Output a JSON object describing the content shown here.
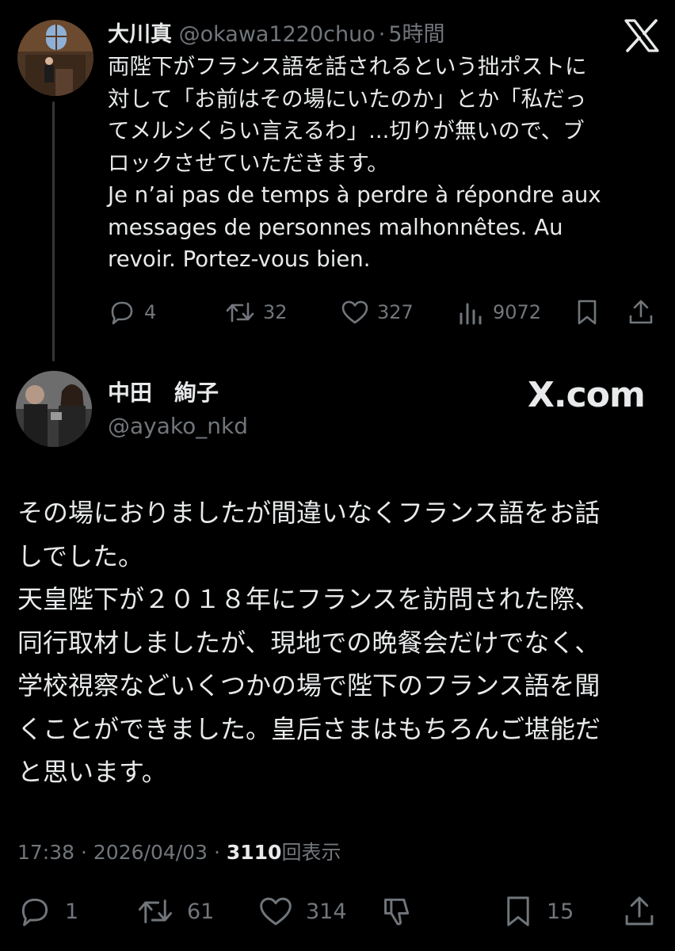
{
  "parent_tweet": {
    "display_name": "大川真",
    "handle": "@okawa1220chuo",
    "separator": "·",
    "time": "5時間",
    "text": "両陛下がフランス語を話されるという拙ポストに\n対して「お前はその場にいたのか」とか「私だっ\nてメルシくらい言えるわ」...切りが無いので、ブ\nロックさせていただきます。\nJe n’ai pas de temps à perdre à répondre aux\nmessages de personnes malhonnêtes. Au\nrevoir. Portez-vous bien.",
    "stats": {
      "replies": "4",
      "reposts": "32",
      "likes": "327",
      "views": "9072"
    }
  },
  "main_tweet": {
    "display_name": "中田　絢子",
    "handle": "@ayako_nkd",
    "brand": "X.com",
    "text": "その場におりましたが間違いなくフランス語をお話\nしでした。\n天皇陛下が２０１８年にフランスを訪問された際、\n同行取材しましたが、現地での晩餐会だけでなく、\n学校視察などいくつかの場で陛下のフランス語を聞\nくことができました。皇后さまはもちろんご堪能だ\nと思います。",
    "time": "17:38",
    "separator": "·",
    "date": "2026/04/03",
    "views_count": "3110",
    "views_label": "回表示",
    "stats": {
      "replies": "1",
      "reposts": "61",
      "likes": "314",
      "bookmarks": "15"
    }
  },
  "icons": [
    "x-logo-icon",
    "reply-icon",
    "repost-icon",
    "like-icon",
    "views-icon",
    "bookmark-icon",
    "share-icon",
    "downvote-icon"
  ],
  "colors": {
    "background": "#000000",
    "text": "#e7e9ea",
    "secondary": "#71767b",
    "thread_line": "#333639"
  }
}
